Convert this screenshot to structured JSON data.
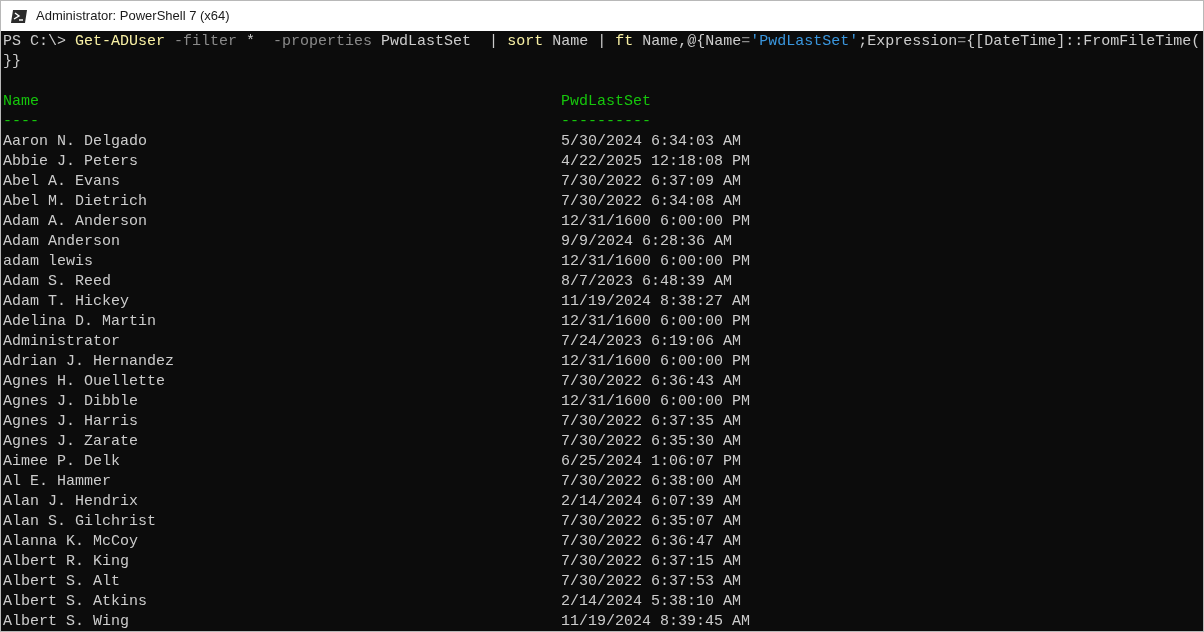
{
  "window": {
    "title": "Administrator: PowerShell 7 (x64)"
  },
  "command_lines": [
    {
      "tokens": [
        {
          "text": "PS C:\\> ",
          "kind": "prompt"
        },
        {
          "text": "Get-ADUser",
          "kind": "command"
        },
        {
          "text": " -filter",
          "kind": "parameter"
        },
        {
          "text": " *  ",
          "kind": "text"
        },
        {
          "text": "-properties",
          "kind": "parameter"
        },
        {
          "text": " PwdLastSet  | ",
          "kind": "text"
        },
        {
          "text": "sort",
          "kind": "command"
        },
        {
          "text": " Name | ",
          "kind": "text"
        },
        {
          "text": "ft",
          "kind": "command"
        },
        {
          "text": " Name,@{Name",
          "kind": "text"
        },
        {
          "text": "=",
          "kind": "operator"
        },
        {
          "text": "'PwdLastSet'",
          "kind": "string"
        },
        {
          "text": ";Expression",
          "kind": "text"
        },
        {
          "text": "=",
          "kind": "operator"
        },
        {
          "text": "{[DateTime]::FromFileTime(",
          "kind": "text"
        }
      ]
    },
    {
      "tokens": [
        {
          "text": "}}",
          "kind": "text"
        }
      ]
    }
  ],
  "table": {
    "columns": [
      {
        "label": "Name",
        "underline": "----"
      },
      {
        "label": "PwdLastSet",
        "underline": "----------"
      }
    ],
    "rows": [
      {
        "name": "Aaron N. Delgado",
        "pwd_last_set": "5/30/2024 6:34:03 AM"
      },
      {
        "name": "Abbie J. Peters",
        "pwd_last_set": "4/22/2025 12:18:08 PM"
      },
      {
        "name": "Abel A. Evans",
        "pwd_last_set": "7/30/2022 6:37:09 AM"
      },
      {
        "name": "Abel M. Dietrich",
        "pwd_last_set": "7/30/2022 6:34:08 AM"
      },
      {
        "name": "Adam A. Anderson",
        "pwd_last_set": "12/31/1600 6:00:00 PM"
      },
      {
        "name": "Adam Anderson",
        "pwd_last_set": "9/9/2024 6:28:36 AM"
      },
      {
        "name": "adam lewis",
        "pwd_last_set": "12/31/1600 6:00:00 PM"
      },
      {
        "name": "Adam S. Reed",
        "pwd_last_set": "8/7/2023 6:48:39 AM"
      },
      {
        "name": "Adam T. Hickey",
        "pwd_last_set": "11/19/2024 8:38:27 AM"
      },
      {
        "name": "Adelina D. Martin",
        "pwd_last_set": "12/31/1600 6:00:00 PM"
      },
      {
        "name": "Administrator",
        "pwd_last_set": "7/24/2023 6:19:06 AM"
      },
      {
        "name": "Adrian J. Hernandez",
        "pwd_last_set": "12/31/1600 6:00:00 PM"
      },
      {
        "name": "Agnes H. Ouellette",
        "pwd_last_set": "7/30/2022 6:36:43 AM"
      },
      {
        "name": "Agnes J. Dibble",
        "pwd_last_set": "12/31/1600 6:00:00 PM"
      },
      {
        "name": "Agnes J. Harris",
        "pwd_last_set": "7/30/2022 6:37:35 AM"
      },
      {
        "name": "Agnes J. Zarate",
        "pwd_last_set": "7/30/2022 6:35:30 AM"
      },
      {
        "name": "Aimee P. Delk",
        "pwd_last_set": "6/25/2024 1:06:07 PM"
      },
      {
        "name": "Al E. Hammer",
        "pwd_last_set": "7/30/2022 6:38:00 AM"
      },
      {
        "name": "Alan J. Hendrix",
        "pwd_last_set": "2/14/2024 6:07:39 AM"
      },
      {
        "name": "Alan S. Gilchrist",
        "pwd_last_set": "7/30/2022 6:35:07 AM"
      },
      {
        "name": "Alanna K. McCoy",
        "pwd_last_set": "7/30/2022 6:36:47 AM"
      },
      {
        "name": "Albert R. King",
        "pwd_last_set": "7/30/2022 6:37:15 AM"
      },
      {
        "name": "Albert S. Alt",
        "pwd_last_set": "7/30/2022 6:37:53 AM"
      },
      {
        "name": "Albert S. Atkins",
        "pwd_last_set": "2/14/2024 5:38:10 AM"
      },
      {
        "name": "Albert S. Wing",
        "pwd_last_set": "11/19/2024 8:39:45 AM"
      }
    ]
  }
}
